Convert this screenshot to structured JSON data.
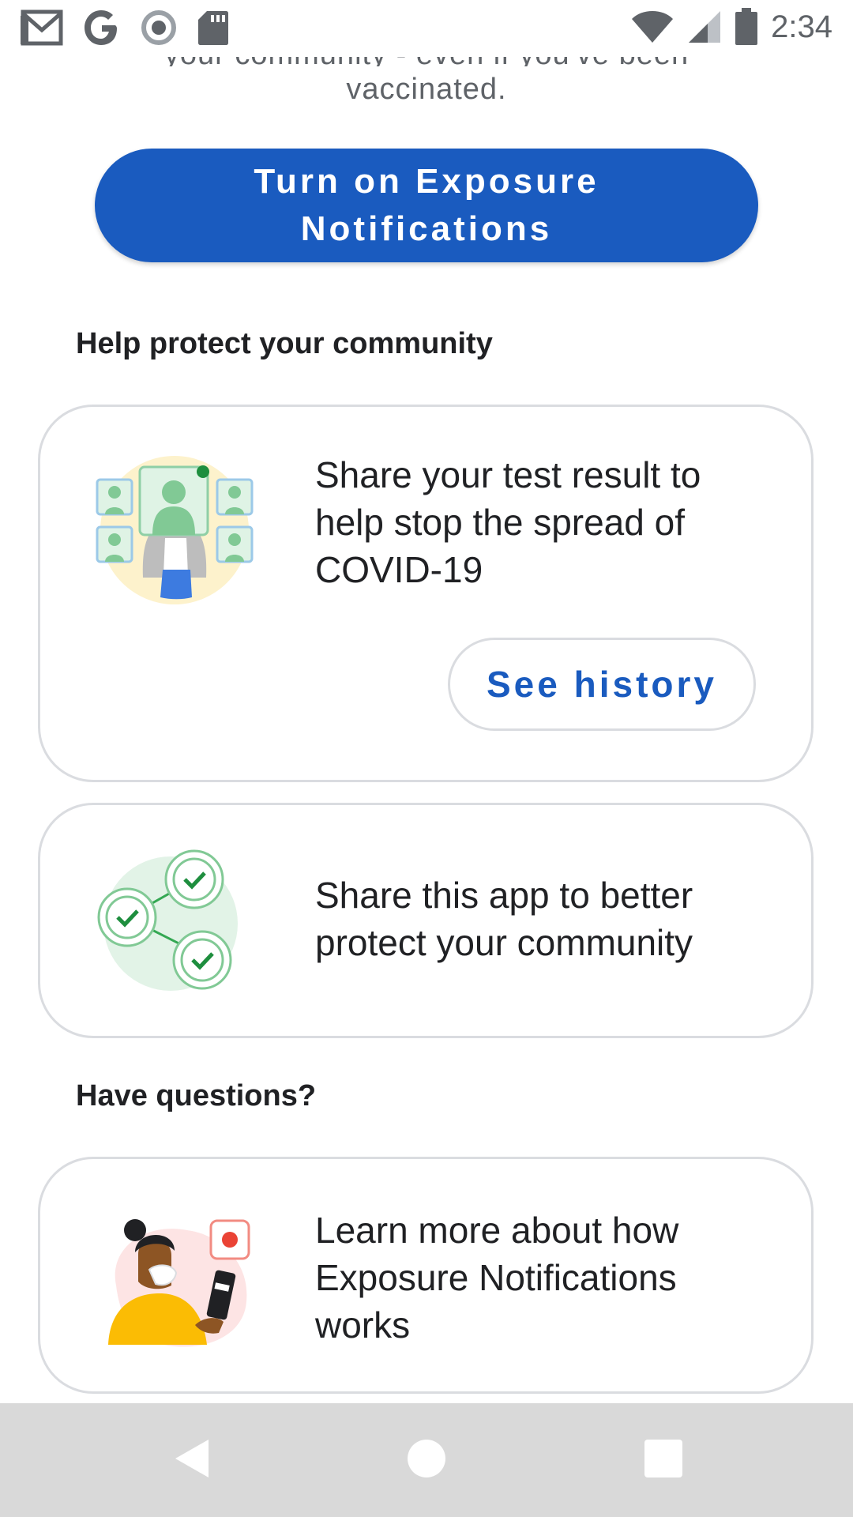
{
  "status_bar": {
    "time": "2:34",
    "left_icons": [
      "gmail-icon",
      "google-icon",
      "circle-record-icon",
      "sd-card-icon"
    ],
    "right_icons": [
      "wifi-icon",
      "cell-signal-icon",
      "battery-icon"
    ]
  },
  "intro": {
    "line1": "your community - even if you've been",
    "line2": "vaccinated."
  },
  "primary_button": {
    "label": "Turn on Exposure Notifications"
  },
  "sections": {
    "community_heading": "Help protect your community",
    "questions_heading": "Have questions?"
  },
  "cards": {
    "share_result": {
      "text": "Share your test result to help stop the spread of COVID-19",
      "button_label": "See history"
    },
    "share_app": {
      "text": "Share this app to better protect your community"
    },
    "learn_more": {
      "text": "Learn more about how Exposure Notifications works"
    }
  },
  "colors": {
    "primary": "#1a5bbf",
    "card_border": "#dadce0",
    "nav_bar": "#d9d9d9",
    "illustration_green": "#81c995"
  }
}
